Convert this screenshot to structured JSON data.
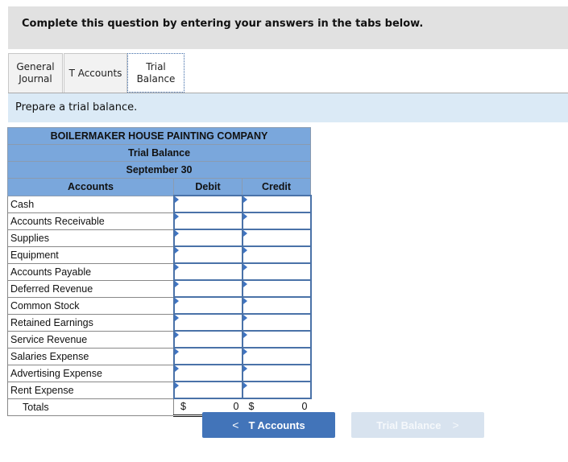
{
  "instruction": "Complete this question by entering your answers in the tabs below.",
  "tabs": [
    {
      "label_line1": "General",
      "label_line2": "Journal",
      "active": false
    },
    {
      "label": "T Accounts",
      "active": false
    },
    {
      "label": "Trial Balance",
      "active": true
    }
  ],
  "prompt": "Prepare a trial balance.",
  "trial_balance": {
    "company": "BOILERMAKER HOUSE PAINTING COMPANY",
    "title": "Trial Balance",
    "date": "September 30",
    "columns": {
      "accounts": "Accounts",
      "debit": "Debit",
      "credit": "Credit"
    },
    "rows": [
      {
        "account": "Cash",
        "debit": "",
        "credit": ""
      },
      {
        "account": "Accounts Receivable",
        "debit": "",
        "credit": ""
      },
      {
        "account": "Supplies",
        "debit": "",
        "credit": ""
      },
      {
        "account": "Equipment",
        "debit": "",
        "credit": ""
      },
      {
        "account": "Accounts Payable",
        "debit": "",
        "credit": ""
      },
      {
        "account": "Deferred Revenue",
        "debit": "",
        "credit": ""
      },
      {
        "account": "Common Stock",
        "debit": "",
        "credit": ""
      },
      {
        "account": "Retained Earnings",
        "debit": "",
        "credit": ""
      },
      {
        "account": "Service Revenue",
        "debit": "",
        "credit": ""
      },
      {
        "account": "Salaries Expense",
        "debit": "",
        "credit": ""
      },
      {
        "account": "Advertising Expense",
        "debit": "",
        "credit": ""
      },
      {
        "account": "Rent Expense",
        "debit": "",
        "credit": ""
      }
    ],
    "totals": {
      "label": "Totals",
      "currency": "$",
      "debit": "0",
      "credit": "0"
    }
  },
  "nav": {
    "prev_label": "T Accounts",
    "prev_icon": "chevron-left-icon",
    "next_label": "Trial Balance",
    "next_icon": "chevron-right-icon",
    "prev_chevron": "<",
    "next_chevron": ">"
  },
  "colors": {
    "header_blue": "#7aa7dc",
    "input_border": "#4a72a8",
    "prev_button": "#4274b9",
    "next_button_disabled": "#d8e3ef",
    "prompt_bg": "#dbeaf6",
    "instruction_bg": "#e1e1e1"
  }
}
